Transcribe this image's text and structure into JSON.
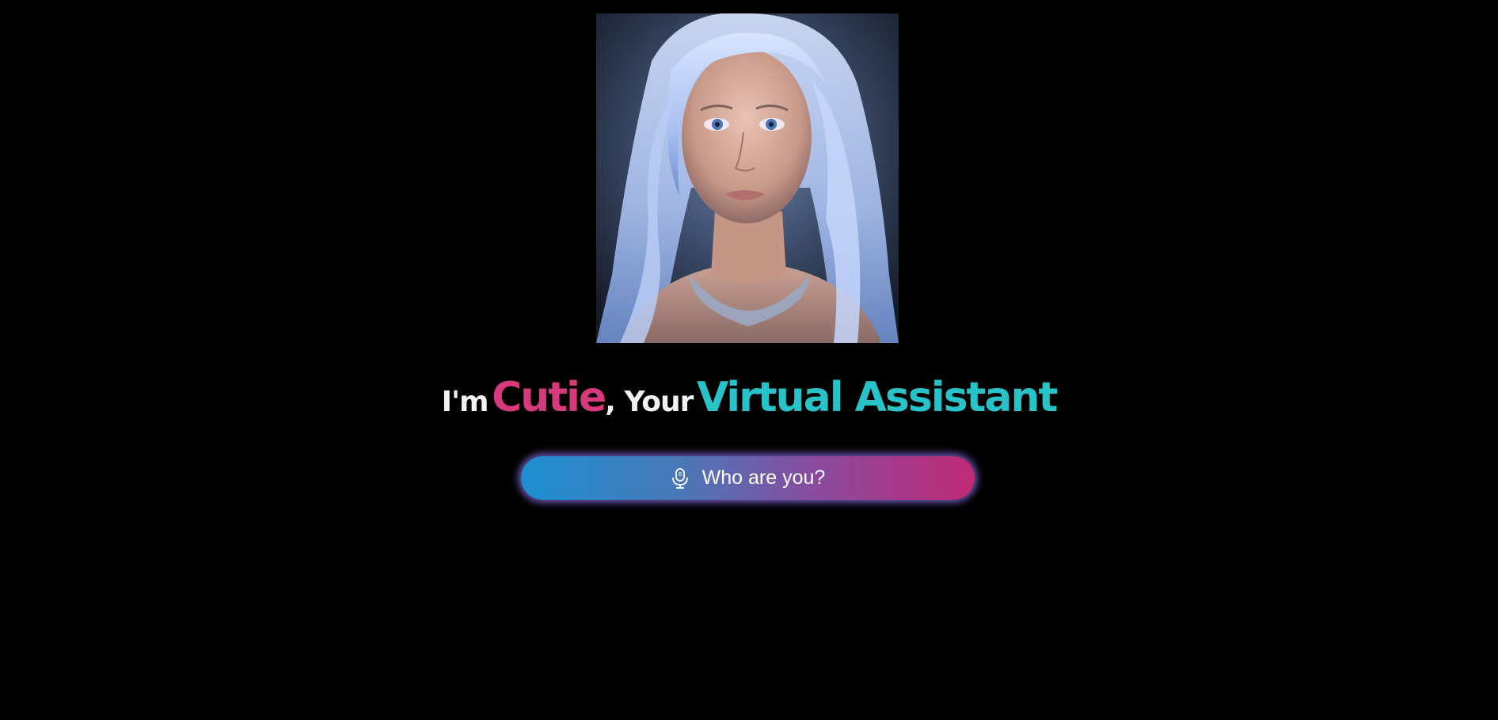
{
  "headline": {
    "prefix": "I'm",
    "name": "Cutie",
    "middle": ", Your",
    "role": "Virtual Assistant"
  },
  "mic_button": {
    "label": "Who are you?",
    "icon": "microphone-icon"
  },
  "portrait": {
    "alt": "assistant-portrait"
  },
  "colors": {
    "background": "#000000",
    "name_accent": "#d63a7c",
    "role_accent": "#27c3c8",
    "button_gradient_start": "#1b8fd0",
    "button_gradient_end": "#c02a75",
    "button_glow": "#8c6ee6"
  }
}
